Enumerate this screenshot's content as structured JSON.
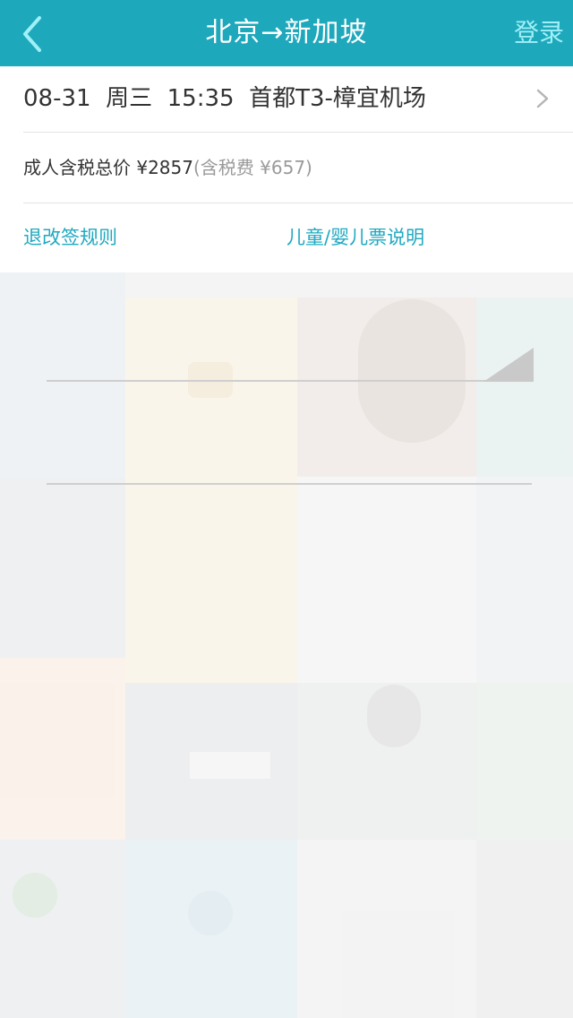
{
  "header": {
    "title": "北京→新加坡",
    "login_label": "登录"
  },
  "flight": {
    "summary": "08-31  周三  15:35  首都T3-樟宜机场"
  },
  "price": {
    "label": "成人含税总价",
    "total": "¥2857",
    "tax_note": "(含税费 ¥657)"
  },
  "links": {
    "rules": "退改签规则",
    "child_ticket": "儿童/婴儿票说明"
  },
  "colors": {
    "header_bg": "#1ea8bb",
    "accent": "#20a9c0"
  },
  "icons": {
    "back": "chevron-left-icon",
    "detail": "chevron-right-icon"
  }
}
